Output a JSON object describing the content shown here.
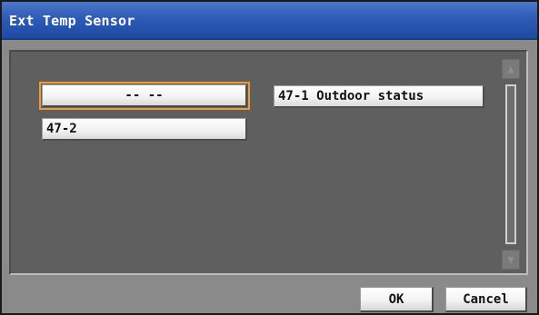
{
  "window": {
    "title": "Ext Temp Sensor"
  },
  "items": [
    {
      "label": "-- --",
      "selected": true
    },
    {
      "label": "47-1 Outdoor status",
      "selected": false
    },
    {
      "label": "47-2",
      "selected": false
    }
  ],
  "scrollbar": {
    "up_icon": "▲",
    "down_icon": "▼"
  },
  "footer": {
    "ok_label": "OK",
    "cancel_label": "Cancel"
  },
  "colors": {
    "title_bar": "#2f5bb6",
    "panel": "#5f5f5f",
    "selection_outline": "#f29a35"
  }
}
